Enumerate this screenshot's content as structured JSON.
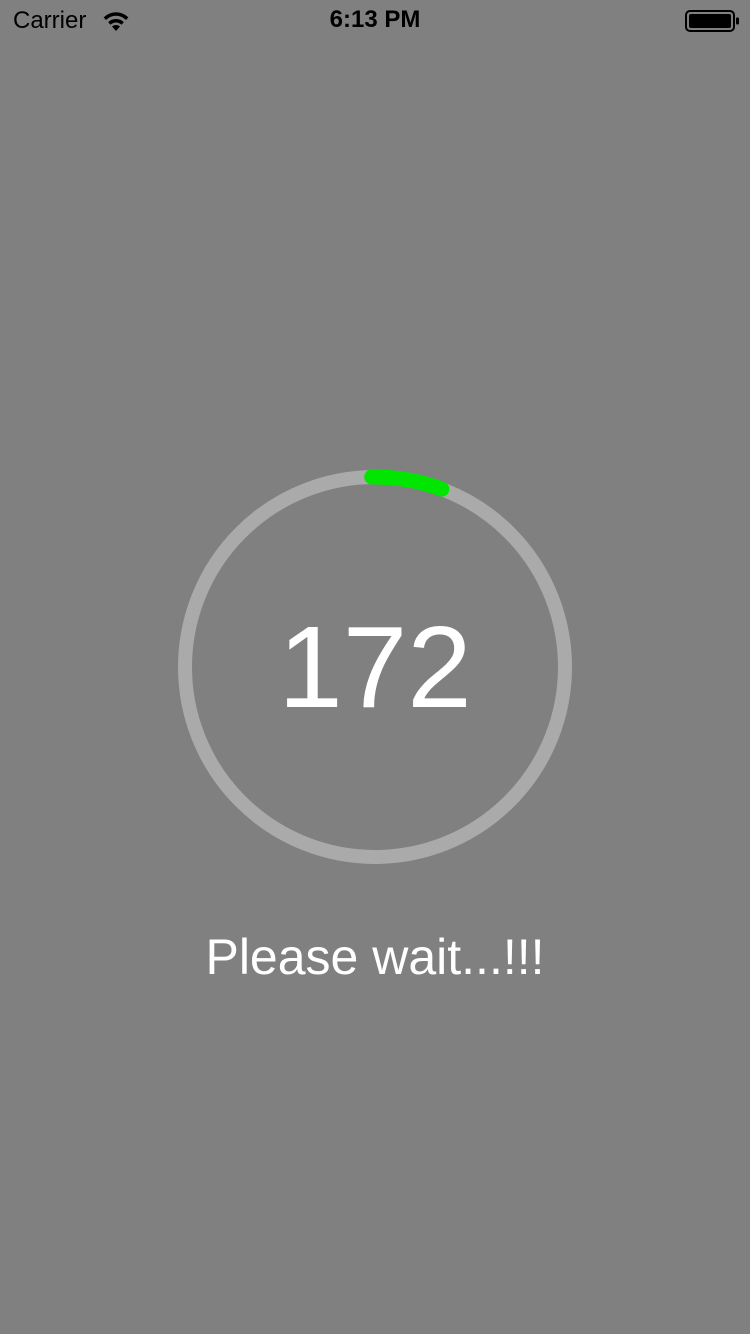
{
  "status_bar": {
    "carrier": "Carrier",
    "time": "6:13 PM",
    "icons": [
      "wifi-icon",
      "battery-icon"
    ]
  },
  "loader": {
    "countdown": "172",
    "progress_fraction": 0.06,
    "message": "Please wait...!!!"
  },
  "colors": {
    "background": "#808080",
    "track": "#aaaaaa",
    "progress": "#00e600",
    "text": "#ffffff",
    "status_text": "#000000"
  }
}
